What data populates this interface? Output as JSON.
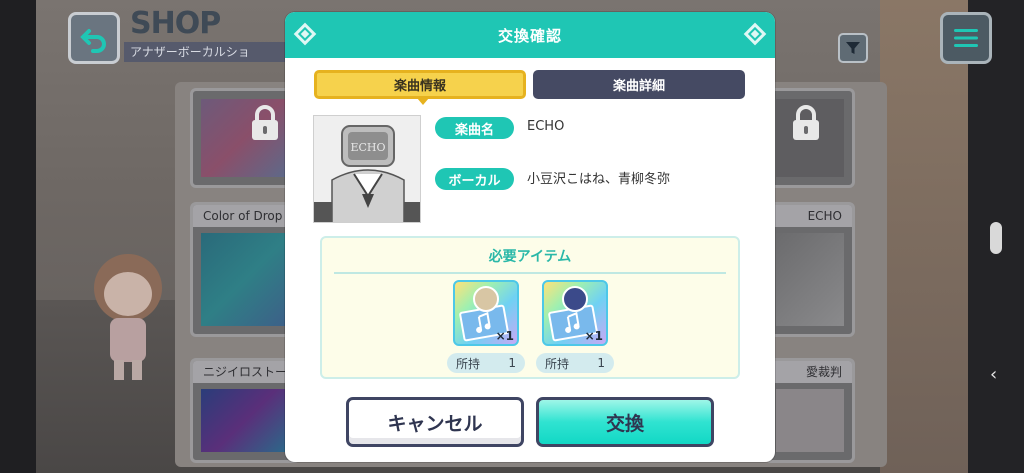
{
  "background": {
    "shop_title": "SHOP",
    "shop_subtitle": "アナザーボーカルショ",
    "cards": [
      {
        "title": "Color of Drop"
      },
      {
        "title": "ECHO"
      },
      {
        "title": "ニジイロストー"
      },
      {
        "title": "愛裁判"
      }
    ]
  },
  "dialog": {
    "title": "交換確認",
    "tabs": {
      "info": "楽曲情報",
      "detail": "楽曲詳細"
    },
    "song_label": "楽曲名",
    "song_value": "ECHO",
    "vocal_label": "ボーカル",
    "vocal_value": "小豆沢こはね、青柳冬弥",
    "jacket_text": "ECHO",
    "required_title": "必要アイテム",
    "items": [
      {
        "qty": "×1",
        "owned_label": "所持",
        "owned_value": "1"
      },
      {
        "qty": "×1",
        "owned_label": "所持",
        "owned_value": "1"
      }
    ],
    "cancel_label": "キャンセル",
    "exchange_label": "交換"
  },
  "colors": {
    "accent": "#1fc6b4",
    "tab_active": "#f6d24c",
    "tab_inactive": "#454a63"
  },
  "icons": [
    "back-arrow-icon",
    "menu-icon",
    "filter-icon",
    "lock-icon",
    "music-ticket-icon"
  ]
}
